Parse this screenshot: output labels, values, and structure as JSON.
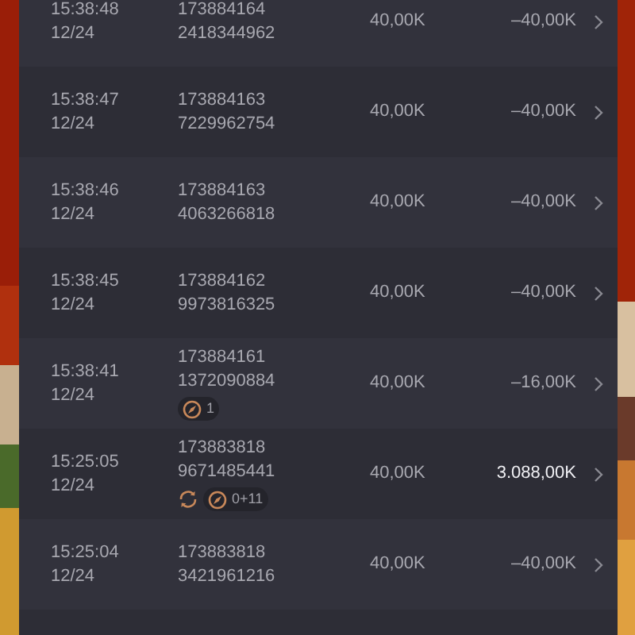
{
  "rows": [
    {
      "time": "15:38:48",
      "date": "12/24",
      "id_1": "173884164",
      "id_2": "2418344962",
      "tags": [],
      "stake": "40,00K",
      "result": "–40,00K",
      "positive": false
    },
    {
      "time": "15:38:47",
      "date": "12/24",
      "id_1": "173884163",
      "id_2": "7229962754",
      "tags": [],
      "stake": "40,00K",
      "result": "–40,00K",
      "positive": false
    },
    {
      "time": "15:38:46",
      "date": "12/24",
      "id_1": "173884163",
      "id_2": "4063266818",
      "tags": [],
      "stake": "40,00K",
      "result": "–40,00K",
      "positive": false
    },
    {
      "time": "15:38:45",
      "date": "12/24",
      "id_1": "173884162",
      "id_2": "9973816325",
      "tags": [],
      "stake": "40,00K",
      "result": "–40,00K",
      "positive": false
    },
    {
      "time": "15:38:41",
      "date": "12/24",
      "id_1": "173884161",
      "id_2": "1372090884",
      "tags": [
        {
          "kind": "compass",
          "label": "1"
        }
      ],
      "stake": "40,00K",
      "result": "–16,00K",
      "positive": false
    },
    {
      "time": "15:25:05",
      "date": "12/24",
      "id_1": "173883818",
      "id_2": "9671485441",
      "tags": [
        {
          "kind": "refresh"
        },
        {
          "kind": "compass",
          "label": "0+11"
        }
      ],
      "stake": "40,00K",
      "result": "3.088,00K",
      "positive": true
    },
    {
      "time": "15:25:04",
      "date": "12/24",
      "id_1": "173883818",
      "id_2": "3421961216",
      "tags": [],
      "stake": "40,00K",
      "result": "–40,00K",
      "positive": false
    }
  ]
}
